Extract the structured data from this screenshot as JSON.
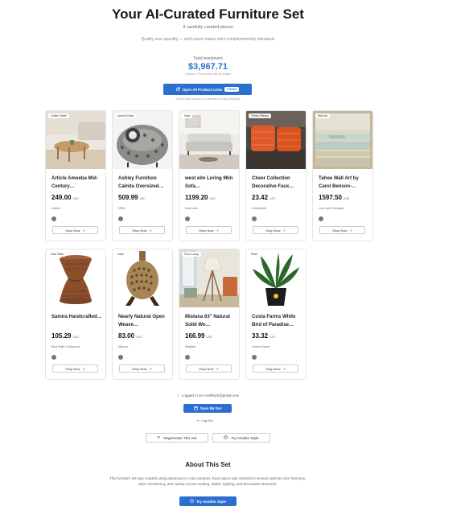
{
  "header": {
    "title": "Your AI-Curated Furniture Set",
    "subtitle": "9 carefully curated pieces",
    "tagline": "Quality over quantity — each piece meets strict complementarity standards"
  },
  "investment": {
    "label": "Total Investment",
    "value": "$3,967.71",
    "note": "9 pieces • Prices may vary by retailer"
  },
  "open_all": {
    "label": "Open All Product Links",
    "count": "9 items",
    "note": "Opens each product in a new tab for easy shopping"
  },
  "cards": [
    {
      "badge": "Coffee Table",
      "name": "Article Amoeba Mid-Century…",
      "price": "249.00",
      "currency": "USD",
      "store": "Article",
      "shop": "Shop Now"
    },
    {
      "badge": "Accent Chair",
      "name": "Ashley Furniture Calnita Oversized…",
      "price": "509.99",
      "currency": "USD",
      "store": "NFM",
      "shop": "Shop Now"
    },
    {
      "badge": "Sofa",
      "name": "west elm Loring 96in Sofa…",
      "price": "1199.20",
      "currency": "USD",
      "store": "west elm",
      "shop": "Shop Now"
    },
    {
      "badge": "Throw Pillows",
      "name": "Cheer Collection Decorative Faux…",
      "price": "23.42",
      "currency": "USD",
      "store": "Overstock",
      "shop": "Shop Now"
    },
    {
      "badge": "Wall Art",
      "name": "Tahoe Wall Art by Carol Benson-…",
      "price": "1597.50",
      "currency": "USD",
      "store": "Lulu and Georgia",
      "shop": "Shop Now"
    },
    {
      "badge": "Side Table",
      "name": "Samira Handcrafted…",
      "price": "105.29",
      "currency": "USD",
      "store": "Bed Bath & Beyond",
      "shop": "Shop Now"
    },
    {
      "badge": "Vase",
      "name": "Nearly Natural Open Weave…",
      "price": "83.00",
      "currency": "USD",
      "store": "Macy's",
      "shop": "Shop Now"
    },
    {
      "badge": "Floor Lamp",
      "name": "Mistana 63\" Natural Solid Wo…",
      "price": "166.99",
      "currency": "USD",
      "store": "Wayfair",
      "shop": "Shop Now"
    },
    {
      "badge": "Plant",
      "name": "Costa Farms White Bird of Paradise…",
      "price": "33.32",
      "currency": "USD",
      "store": "Home Depot",
      "shop": "Shop Now"
    }
  ],
  "account": {
    "login_text": "Logged in as mzafhsjm@gmail.com",
    "save_label": "Save My Set",
    "logout_label": "Log Out"
  },
  "actions": {
    "regenerate_label": "Regenerate This Set",
    "try_style_label": "Try Another Style"
  },
  "about": {
    "title": "About This Set",
    "text": "This furniture set was curated using advanced AI color analysis. Each piece was selected to ensure optimal color harmony, style consistency, and variety across seating, tables, lighting, and decorative elements.",
    "button_label": "Try Another Style"
  },
  "colors": {
    "accent": "#2d6fcf",
    "success": "#4caf50"
  }
}
